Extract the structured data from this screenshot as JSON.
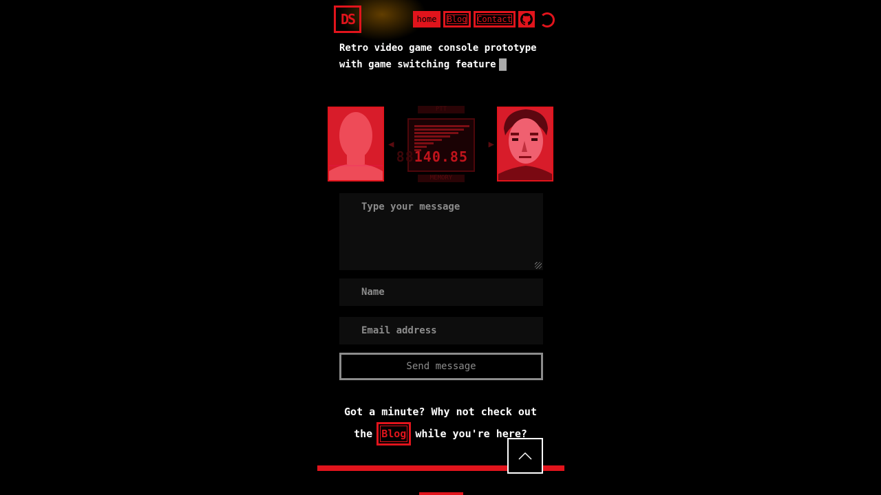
{
  "logo": {
    "text": "DS"
  },
  "nav": {
    "items": [
      {
        "label": "home",
        "active": true
      },
      {
        "label": "Blog",
        "active": false
      },
      {
        "label": "Contact",
        "active": false
      }
    ],
    "github_icon": "github-icon",
    "theme_icon": "loading-spinner-icon"
  },
  "tagline": {
    "line1": "Retro video game console prototype",
    "line2": "with game switching feature"
  },
  "codec": {
    "top_label": "PTT",
    "bottom_label": "MEMORY",
    "frequency": "140.85",
    "frequency_dim": "88"
  },
  "form": {
    "message_placeholder": "Type your message",
    "name_placeholder": "Name",
    "email_placeholder": "Email address",
    "send_label": "Send message"
  },
  "cta": {
    "text_before": "Got a minute? Why not check out",
    "text_the": "the",
    "link_label": "Blog",
    "text_after": "while you're here?"
  },
  "colors": {
    "accent": "#e1141c",
    "background": "#000000",
    "field": "#0d0d0d",
    "muted": "#8c8c8c"
  }
}
